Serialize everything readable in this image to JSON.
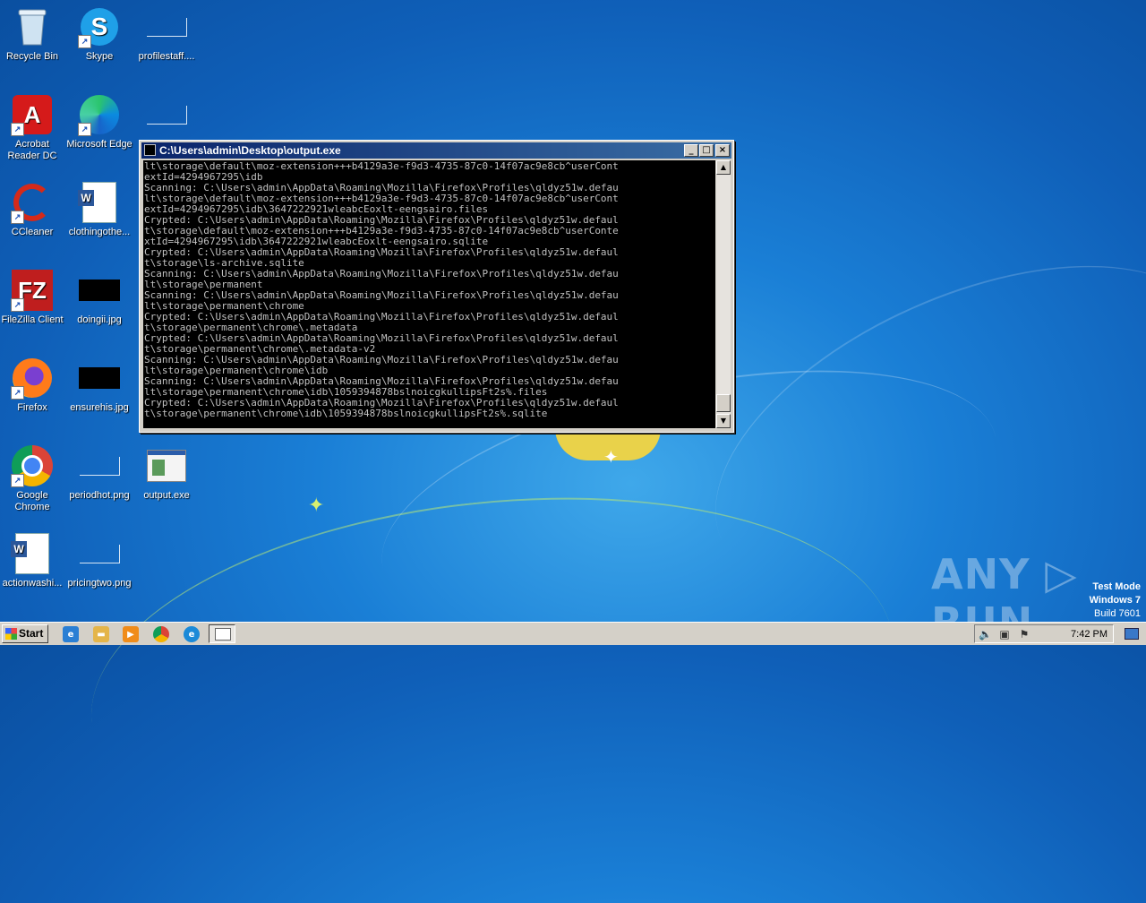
{
  "desktop": {
    "icons": [
      {
        "label": "Recycle Bin"
      },
      {
        "label": "Skype"
      },
      {
        "label": "profilestaff...."
      },
      {
        "label": "Acrobat Reader DC"
      },
      {
        "label": "Microsoft Edge"
      },
      {
        "label": "CCleaner"
      },
      {
        "label": "clothingothe..."
      },
      {
        "label": "FileZilla Client"
      },
      {
        "label": "doingii.jpg"
      },
      {
        "label": "Firefox"
      },
      {
        "label": "ensurehis.jpg"
      },
      {
        "label": "Google Chrome"
      },
      {
        "label": "periodhot.png"
      },
      {
        "label": "output.exe"
      },
      {
        "label": "actionwashi..."
      },
      {
        "label": "pricingtwo.png"
      }
    ]
  },
  "console": {
    "title": "C:\\Users\\admin\\Desktop\\output.exe",
    "lines": [
      "lt\\storage\\default\\moz-extension+++b4129a3e-f9d3-4735-87c0-14f07ac9e8cb^userCont",
      "extId=4294967295\\idb",
      "Scanning: C:\\Users\\admin\\AppData\\Roaming\\Mozilla\\Firefox\\Profiles\\qldyz51w.defau",
      "lt\\storage\\default\\moz-extension+++b4129a3e-f9d3-4735-87c0-14f07ac9e8cb^userCont",
      "extId=4294967295\\idb\\3647222921wleabcEoxlt-eengsairo.files",
      "Crypted: C:\\Users\\admin\\AppData\\Roaming\\Mozilla\\Firefox\\Profiles\\qldyz51w.defaul",
      "t\\storage\\default\\moz-extension+++b4129a3e-f9d3-4735-87c0-14f07ac9e8cb^userConte",
      "xtId=4294967295\\idb\\3647222921wleabcEoxlt-eengsairo.sqlite",
      "Crypted: C:\\Users\\admin\\AppData\\Roaming\\Mozilla\\Firefox\\Profiles\\qldyz51w.defaul",
      "t\\storage\\ls-archive.sqlite",
      "Scanning: C:\\Users\\admin\\AppData\\Roaming\\Mozilla\\Firefox\\Profiles\\qldyz51w.defau",
      "lt\\storage\\permanent",
      "Scanning: C:\\Users\\admin\\AppData\\Roaming\\Mozilla\\Firefox\\Profiles\\qldyz51w.defau",
      "lt\\storage\\permanent\\chrome",
      "Crypted: C:\\Users\\admin\\AppData\\Roaming\\Mozilla\\Firefox\\Profiles\\qldyz51w.defaul",
      "t\\storage\\permanent\\chrome\\.metadata",
      "Crypted: C:\\Users\\admin\\AppData\\Roaming\\Mozilla\\Firefox\\Profiles\\qldyz51w.defaul",
      "t\\storage\\permanent\\chrome\\.metadata-v2",
      "Scanning: C:\\Users\\admin\\AppData\\Roaming\\Mozilla\\Firefox\\Profiles\\qldyz51w.defau",
      "lt\\storage\\permanent\\chrome\\idb",
      "Scanning: C:\\Users\\admin\\AppData\\Roaming\\Mozilla\\Firefox\\Profiles\\qldyz51w.defau",
      "lt\\storage\\permanent\\chrome\\idb\\1059394878bslnoicgkullipsFt2s%.files",
      "Crypted: C:\\Users\\admin\\AppData\\Roaming\\Mozilla\\Firefox\\Profiles\\qldyz51w.defaul",
      "t\\storage\\permanent\\chrome\\idb\\1059394878bslnoicgkullipsFt2s%.sqlite"
    ],
    "buttons": {
      "minimize": "_",
      "maximize": "□",
      "close": "×"
    }
  },
  "watermark": {
    "brand": "ANY ▷ RUN",
    "test_mode": "Test Mode",
    "os": "Windows 7",
    "build": "Build 7601"
  },
  "taskbar": {
    "start_label": "Start",
    "clock": "7:42 PM",
    "quicklaunch": [
      "ie-icon",
      "explorer-icon",
      "media-player-icon",
      "chrome-icon",
      "edge-icon"
    ],
    "active_task": "output-exe-task"
  },
  "colors": {
    "titlebar_start": "#0a246a",
    "titlebar_end": "#3a6ea5",
    "console_text": "#c0c0c0",
    "console_bg": "#000000"
  }
}
